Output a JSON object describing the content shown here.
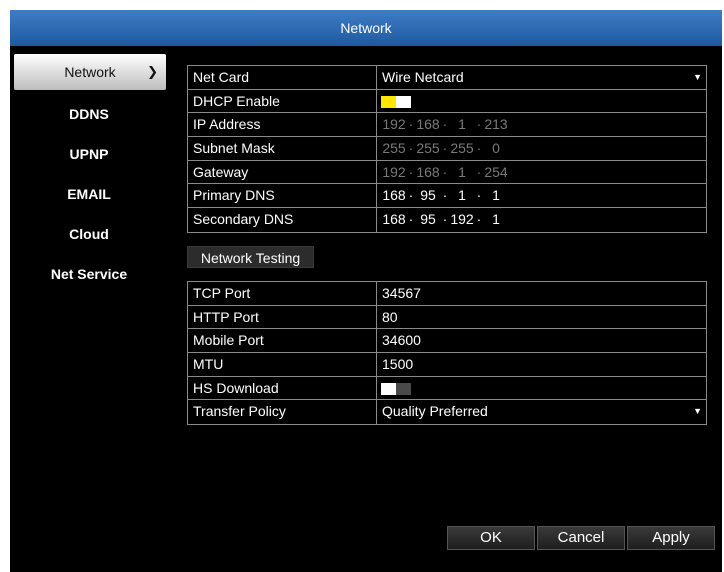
{
  "title": "Network",
  "sidebar": {
    "items": [
      {
        "label": "Network",
        "active": true
      },
      {
        "label": "DDNS"
      },
      {
        "label": "UPNP"
      },
      {
        "label": "EMAIL"
      },
      {
        "label": "Cloud"
      },
      {
        "label": "Net Service"
      }
    ],
    "active_indicator": "chevron-right-icon"
  },
  "network_settings": {
    "net_card": {
      "label": "Net Card",
      "value": "Wire Netcard"
    },
    "dhcp_enable": {
      "label": "DHCP Enable",
      "value": true
    },
    "ip_address": {
      "label": "IP Address",
      "octets": [
        "192",
        "168",
        "1",
        "213"
      ]
    },
    "subnet_mask": {
      "label": "Subnet Mask",
      "octets": [
        "255",
        "255",
        "255",
        "0"
      ]
    },
    "gateway": {
      "label": "Gateway",
      "octets": [
        "192",
        "168",
        "1",
        "254"
      ]
    },
    "primary_dns": {
      "label": "Primary DNS",
      "octets": [
        "168",
        "95",
        "1",
        "1"
      ]
    },
    "secondary_dns": {
      "label": "Secondary DNS",
      "octets": [
        "168",
        "95",
        "192",
        "1"
      ]
    }
  },
  "network_testing_label": "Network Testing",
  "ports": {
    "tcp_port": {
      "label": "TCP Port",
      "value": "34567"
    },
    "http_port": {
      "label": "HTTP Port",
      "value": "80"
    },
    "mobile_port": {
      "label": "Mobile Port",
      "value": "34600"
    },
    "mtu": {
      "label": "MTU",
      "value": "1500"
    },
    "hs_download": {
      "label": "HS Download",
      "value": false
    },
    "transfer_policy": {
      "label": "Transfer Policy",
      "value": "Quality Preferred"
    }
  },
  "buttons": {
    "ok": "OK",
    "cancel": "Cancel",
    "apply": "Apply"
  },
  "colors": {
    "title_bar": "#2f6db5",
    "toggle_on": "#ffe800",
    "background": "#000000"
  }
}
